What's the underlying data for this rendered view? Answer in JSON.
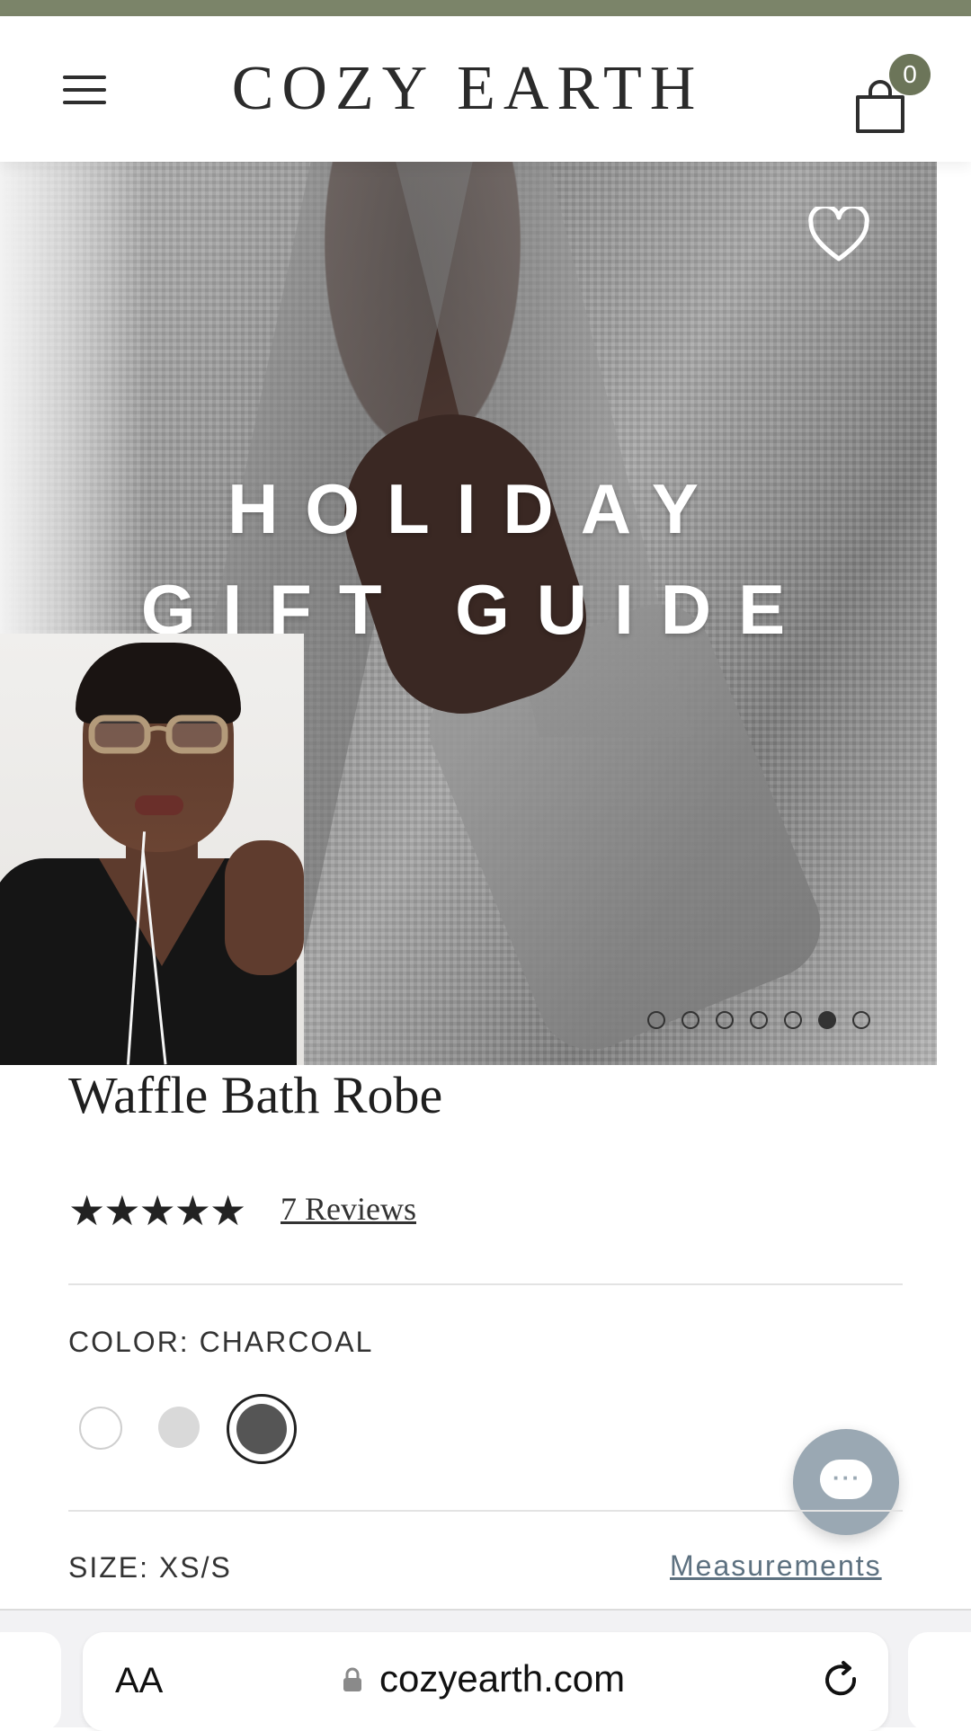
{
  "header": {
    "brand": "COZY EARTH",
    "cart_count": "0"
  },
  "hero": {
    "title_line1": "HOLIDAY",
    "title_line2": "GIFT GUIDE",
    "carousel": {
      "total": 7,
      "active_index": 5
    }
  },
  "product": {
    "title": "Waffle Bath Robe",
    "rating_stars": 5,
    "reviews_label": "7 Reviews",
    "color_label": "COLOR:",
    "color_value": "CHARCOAL",
    "swatches": [
      {
        "name": "White",
        "hex": "#ffffff"
      },
      {
        "name": "Light Grey",
        "hex": "#d9d9d9"
      },
      {
        "name": "Charcoal",
        "hex": "#555555",
        "selected": true
      }
    ],
    "size_label": "SIZE:",
    "size_value": "XS/S",
    "measurements_link": "Measurements"
  },
  "browser": {
    "text_size_button": "AA",
    "url": "cozyearth.com"
  },
  "colors": {
    "brand_green": "#7b8469",
    "badge": "#6c7559",
    "chat_button": "#9aa8b3",
    "link": "#5d7180"
  }
}
